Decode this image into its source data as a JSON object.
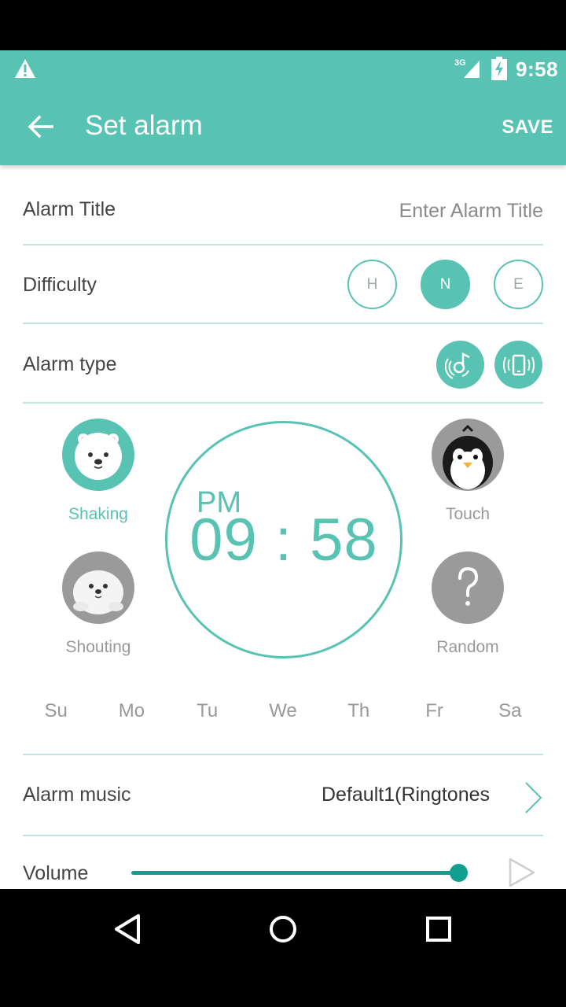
{
  "status_bar": {
    "network": "3G",
    "time": "9:58"
  },
  "app_bar": {
    "title": "Set alarm",
    "save_label": "SAVE"
  },
  "alarm_title": {
    "label": "Alarm Title",
    "placeholder": "Enter Alarm Title",
    "value": ""
  },
  "difficulty": {
    "label": "Difficulty",
    "options": [
      {
        "label": "H",
        "selected": false
      },
      {
        "label": "N",
        "selected": true
      },
      {
        "label": "E",
        "selected": false
      }
    ]
  },
  "alarm_type": {
    "label": "Alarm type",
    "options": [
      "music-sound-icon",
      "vibration-icon"
    ]
  },
  "modes": [
    {
      "label": "Shaking",
      "icon": "polar-bear-icon",
      "selected": true
    },
    {
      "label": "Touch",
      "icon": "penguin-icon",
      "selected": false
    },
    {
      "label": "Shouting",
      "icon": "seal-icon",
      "selected": false
    },
    {
      "label": "Random",
      "icon": "question-mark-icon",
      "selected": false
    }
  ],
  "clock": {
    "ampm": "PM",
    "time": "09 : 58"
  },
  "days": [
    "Su",
    "Mo",
    "Tu",
    "We",
    "Th",
    "Fr",
    "Sa"
  ],
  "alarm_music": {
    "label": "Alarm music",
    "value": "Default1(Ringtones"
  },
  "volume": {
    "label": "Volume",
    "level": 0.98
  },
  "colors": {
    "accent": "#58c2b3",
    "slider": "#11a08f",
    "divider": "#bfe6e0",
    "inactive": "#999999"
  }
}
